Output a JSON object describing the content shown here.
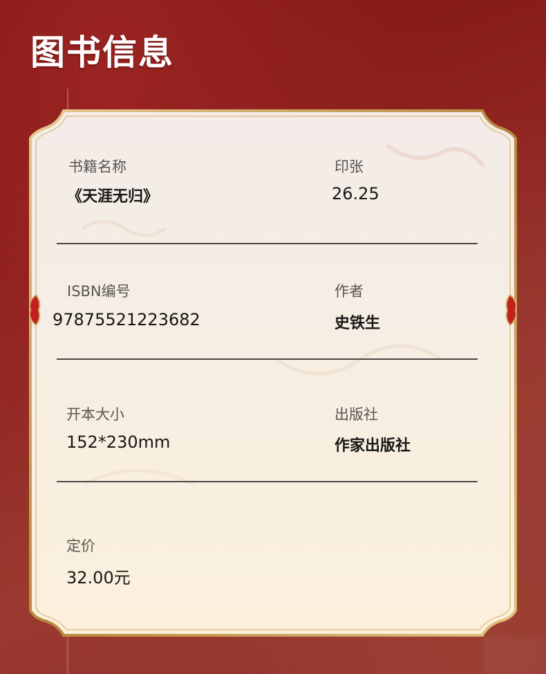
{
  "page": {
    "title": "图书信息"
  },
  "fields": [
    {
      "label": "书籍名称",
      "value": "《天涯无归》"
    },
    {
      "label": "印张",
      "value": "26.25"
    },
    {
      "label": "ISBN编号",
      "value": "9787552122368​2"
    },
    {
      "label": "作者",
      "value": "史铁生"
    },
    {
      "label": "开本大小",
      "value": "152*230mm"
    },
    {
      "label": "出版社",
      "value": "作家出版社"
    },
    {
      "label": "定价",
      "value": "32.00元"
    }
  ],
  "colors": {
    "background": "#8e2320",
    "card": "#f7efe4",
    "gold_border": "#c9a15b",
    "accent_red": "#c0201f"
  }
}
